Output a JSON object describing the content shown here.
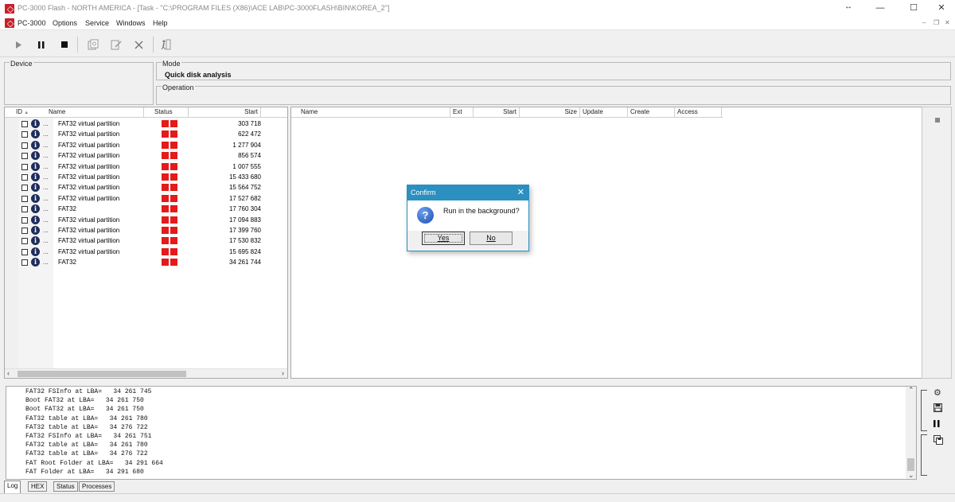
{
  "window": {
    "title": "PC-3000 Flash - NORTH AMERICA - [Task - \"C:\\PROGRAM FILES (X86)\\ACE LAB\\PC-3000FLASH\\BIN\\KOREA_2\"]",
    "minimize": "—",
    "maximize": "☐",
    "close": "✕",
    "resize": "↔"
  },
  "menu": {
    "items": [
      "PC-3000",
      "Options",
      "Service",
      "Windows",
      "Help"
    ],
    "mdi_minimize": "–",
    "mdi_restore": "❐",
    "mdi_close": "✕"
  },
  "toolbar": {
    "play_icon": "play-icon",
    "pause_icon": "pause-icon",
    "stop_icon": "stop-icon"
  },
  "panels": {
    "device_label": "Device",
    "mode_label": "Mode",
    "mode_value": "Quick disk  analysis",
    "operation_label": "Operation"
  },
  "partition_table": {
    "headers": {
      "id": "ID",
      "name": "Name",
      "status": "Status",
      "start": "Start"
    },
    "rows": [
      {
        "name": "FAT32 virtual partition",
        "start": "303 718"
      },
      {
        "name": "FAT32 virtual partition",
        "start": "622 472"
      },
      {
        "name": "FAT32 virtual partition",
        "start": "1 277 904"
      },
      {
        "name": "FAT32 virtual partition",
        "start": "856 574"
      },
      {
        "name": "FAT32 virtual partition",
        "start": "1 007 555"
      },
      {
        "name": "FAT32 virtual partition",
        "start": "15 433 680"
      },
      {
        "name": "FAT32 virtual partition",
        "start": "15 564 752"
      },
      {
        "name": "FAT32 virtual partition",
        "start": "17 527 682"
      },
      {
        "name": "FAT32",
        "start": "17 760 304"
      },
      {
        "name": "FAT32 virtual partition",
        "start": "17 094 883"
      },
      {
        "name": "FAT32 virtual partition",
        "start": "17 399 760"
      },
      {
        "name": "FAT32 virtual partition",
        "start": "17 530 832"
      },
      {
        "name": "FAT32 virtual partition",
        "start": "15 695 824"
      },
      {
        "name": "FAT32",
        "start": "34 261 744"
      }
    ],
    "status_color": "#e41b1b"
  },
  "file_table": {
    "headers": [
      "Name",
      "Ext",
      "Start",
      "Size",
      "Update",
      "Create",
      "Access"
    ]
  },
  "log": {
    "lines": [
      "FAT32 FSInfo at LBA=   34 261 745",
      "Boot FAT32 at LBA=   34 261 750",
      "Boot FAT32 at LBA=   34 261 750",
      "FAT32 table at LBA=   34 261 780",
      "FAT32 table at LBA=   34 276 722",
      "FAT32 FSInfo at LBA=   34 261 751",
      "FAT32 table at LBA=   34 261 780",
      "FAT32 table at LBA=   34 276 722",
      "FAT Root Folder at LBA=   34 291 664",
      "FAT Folder at LBA=   34 291 680"
    ]
  },
  "bottom_tabs": [
    "Log",
    "HEX",
    "Status",
    "Processes"
  ],
  "dialog": {
    "title": "Confirm",
    "message": "Run in the background?",
    "yes_label": "Yes",
    "no_label": "No",
    "accent": "#2b8fc0"
  }
}
